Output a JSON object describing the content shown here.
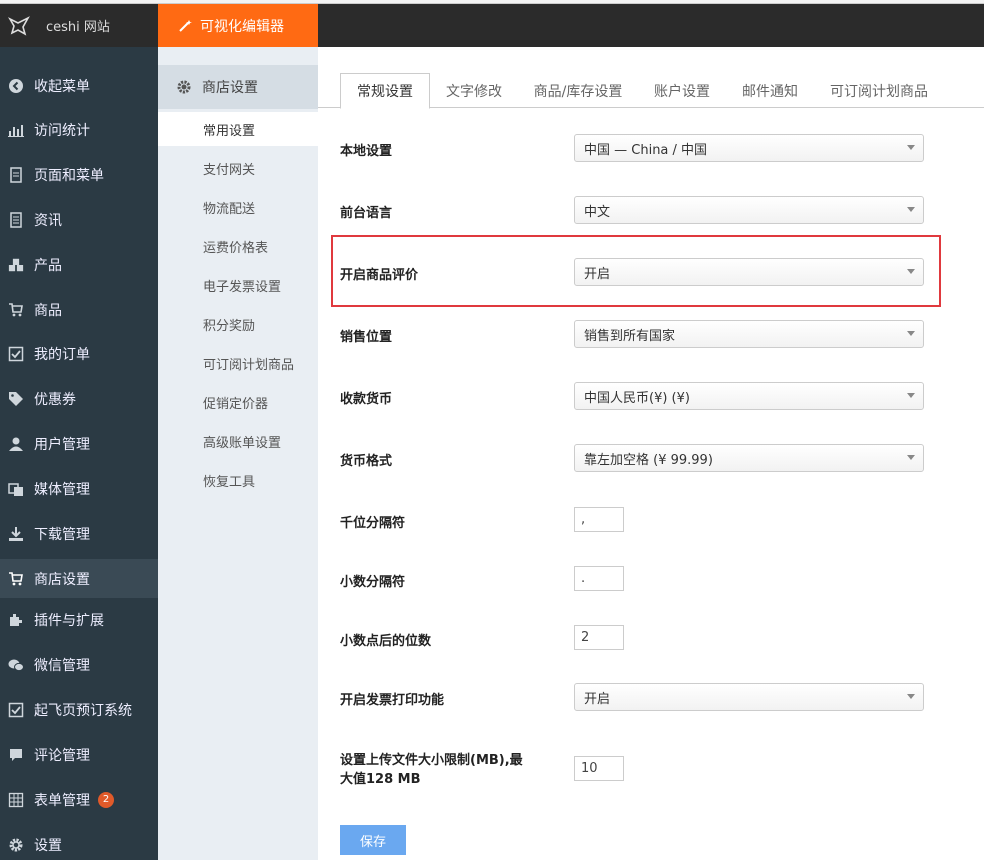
{
  "brand": {
    "site_name": "ceshi 网站"
  },
  "topbar": {
    "editor_label": "可视化编辑器"
  },
  "sidebar": {
    "items": [
      {
        "label": "收起菜单",
        "icon": "collapse-icon"
      },
      {
        "label": "访问统计",
        "icon": "bar-chart-icon"
      },
      {
        "label": "页面和菜单",
        "icon": "pages-icon"
      },
      {
        "label": "资讯",
        "icon": "document-icon"
      },
      {
        "label": "产品",
        "icon": "cubes-icon"
      },
      {
        "label": "商品",
        "icon": "cart-icon"
      },
      {
        "label": "我的订单",
        "icon": "checkbox-icon"
      },
      {
        "label": "优惠券",
        "icon": "tag-icon"
      },
      {
        "label": "用户管理",
        "icon": "user-icon"
      },
      {
        "label": "媒体管理",
        "icon": "media-icon"
      },
      {
        "label": "下载管理",
        "icon": "download-icon"
      },
      {
        "label": "商店设置",
        "icon": "cart-icon"
      },
      {
        "label": "插件与扩展",
        "icon": "plugin-icon"
      },
      {
        "label": "微信管理",
        "icon": "wechat-icon"
      },
      {
        "label": "起飞页预订系统",
        "icon": "checkbox-icon"
      },
      {
        "label": "评论管理",
        "icon": "comment-icon"
      },
      {
        "label": "表单管理",
        "icon": "table-icon",
        "badge": "2"
      },
      {
        "label": "设置",
        "icon": "gear-icon"
      }
    ],
    "active_index": 11
  },
  "subnav": {
    "title": "商店设置",
    "items": [
      "常用设置",
      "支付网关",
      "物流配送",
      "运费价格表",
      "电子发票设置",
      "积分奖励",
      "可订阅计划商品",
      "促销定价器",
      "高级账单设置",
      "恢复工具"
    ],
    "active_index": 0
  },
  "tabs": [
    "常规设置",
    "文字修改",
    "商品/库存设置",
    "账户设置",
    "邮件通知",
    "可订阅计划商品"
  ],
  "form": {
    "local": {
      "label": "本地设置",
      "value": "中国 — China / 中国"
    },
    "language": {
      "label": "前台语言",
      "value": "中文"
    },
    "reviews": {
      "label": "开启商品评价",
      "value": "开启"
    },
    "sell_location": {
      "label": "销售位置",
      "value": "销售到所有国家"
    },
    "currency": {
      "label": "收款货币",
      "value": "中国人民币(¥) (¥)"
    },
    "currency_format": {
      "label": "货币格式",
      "value": "靠左加空格 (¥ 99.99)"
    },
    "thousand_sep": {
      "label": "千位分隔符",
      "value": ","
    },
    "decimal_sep": {
      "label": "小数分隔符",
      "value": "."
    },
    "decimals": {
      "label": "小数点后的位数",
      "value": "2"
    },
    "invoice_print": {
      "label": "开启发票打印功能",
      "value": "开启"
    },
    "upload_limit": {
      "label_line1": "设置上传文件大小限制(MB),最",
      "label_line2": "大值128 MB",
      "value": "10"
    },
    "save_label": "保存"
  },
  "colors": {
    "accent": "#ff6a13",
    "sidebar_bg": "#2b3a44",
    "highlight": "#e0393e",
    "save_button": "#6aa8f0"
  }
}
